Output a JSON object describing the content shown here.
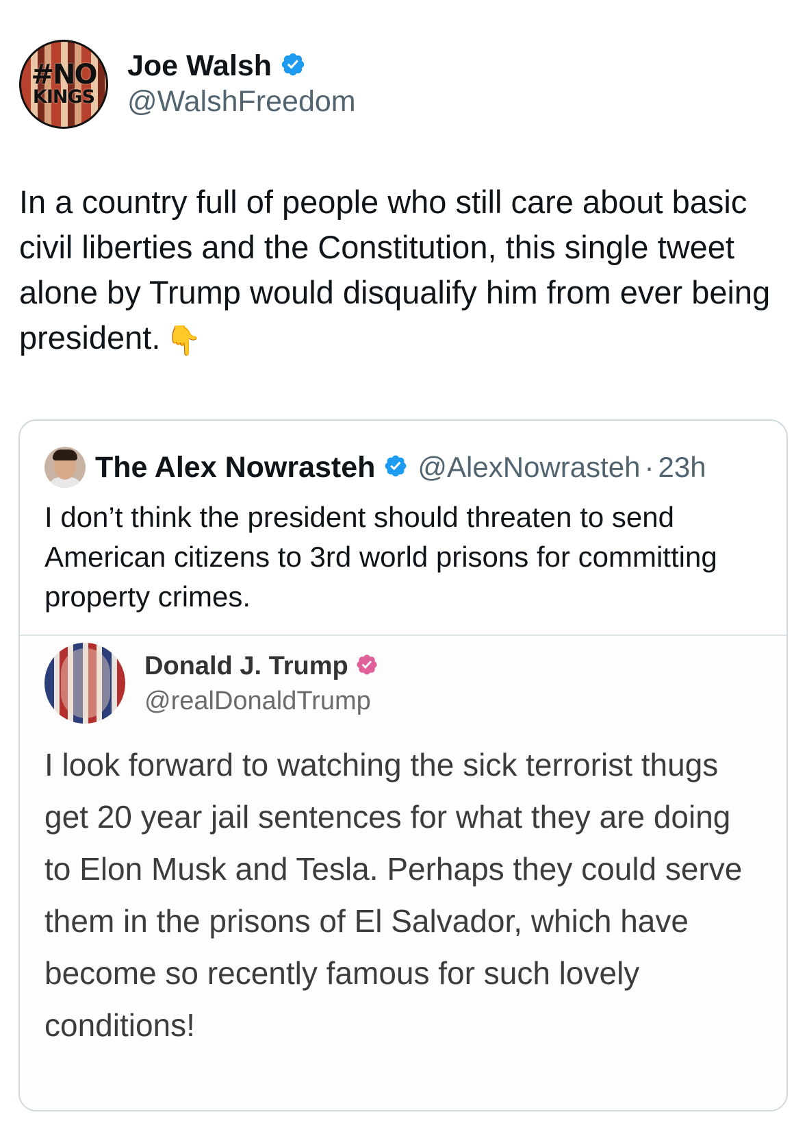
{
  "author": {
    "display_name": "Joe Walsh",
    "handle": "@WalshFreedom",
    "avatar_text_line1": "#NO",
    "avatar_text_line2": "KINGS",
    "verified": true
  },
  "tweet": {
    "text": "In a country full of people who still care about basic civil liberties and the Constitution, this single tweet alone by Trump would disqualify him from ever being president.",
    "emoji": "👇"
  },
  "quoted": {
    "display_name": "The Alex Nowrasteh",
    "handle": "@AlexNowrasteh",
    "separator": "·",
    "time": "23h",
    "verified": true,
    "text": "I don’t think the president should threaten to send American citizens to 3rd world prisons for committing property crimes.",
    "embedded_post": {
      "display_name": "Donald J. Trump",
      "handle": "@realDonaldTrump",
      "badge_color": "#e0609a",
      "text": "I look forward to watching the sick terrorist thugs get 20 year jail sentences for what they are doing to Elon Musk and Tesla. Perhaps they could serve them in the prisons of El Salvador, which have become so recently famous for such lovely conditions!"
    }
  },
  "colors": {
    "verified_blue": "#1d9bf0",
    "text_primary": "#0f1419",
    "text_secondary": "#536471",
    "card_border": "#cfd9de"
  }
}
